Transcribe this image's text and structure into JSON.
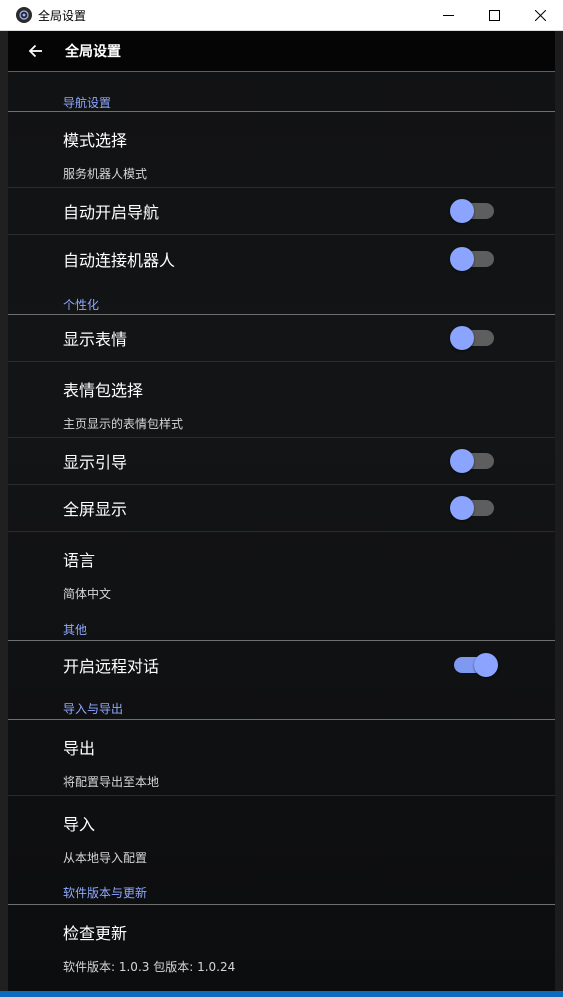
{
  "window": {
    "title": "全局设置",
    "minimize_icon": "minimize-icon",
    "maximize_icon": "maximize-icon",
    "close_icon": "close-icon"
  },
  "header": {
    "back_icon": "arrow-left-icon",
    "title": "全局设置"
  },
  "colors": {
    "accent": "#8ea8ff",
    "toggle_thumb": "#8aa4ff",
    "toggle_track_off": "#5e5e5e",
    "header_border": "#4a57b8"
  },
  "sections": {
    "navigation": {
      "label": "导航设置",
      "mode": {
        "title": "模式选择",
        "subtitle": "服务机器人模式"
      },
      "auto_nav": {
        "title": "自动开启导航",
        "on": false
      },
      "auto_connect": {
        "title": "自动连接机器人",
        "on": false
      }
    },
    "personalization": {
      "label": "个性化",
      "show_expression": {
        "title": "显示表情",
        "on": false
      },
      "expression_pack": {
        "title": "表情包选择",
        "subtitle": "主页显示的表情包样式"
      },
      "show_guide": {
        "title": "显示引导",
        "on": false
      },
      "fullscreen": {
        "title": "全屏显示",
        "on": false
      },
      "language": {
        "title": "语言",
        "subtitle": "简体中文"
      }
    },
    "other": {
      "label": "其他",
      "remote_dialog": {
        "title": "开启远程对话",
        "on": true
      }
    },
    "import_export": {
      "label": "导入与导出",
      "export": {
        "title": "导出",
        "subtitle": "将配置导出至本地"
      },
      "import": {
        "title": "导入",
        "subtitle": "从本地导入配置"
      }
    },
    "version": {
      "label": "软件版本与更新",
      "check_update": {
        "title": "检查更新",
        "subtitle": "软件版本: 1.0.3 包版本: 1.0.24"
      }
    }
  }
}
